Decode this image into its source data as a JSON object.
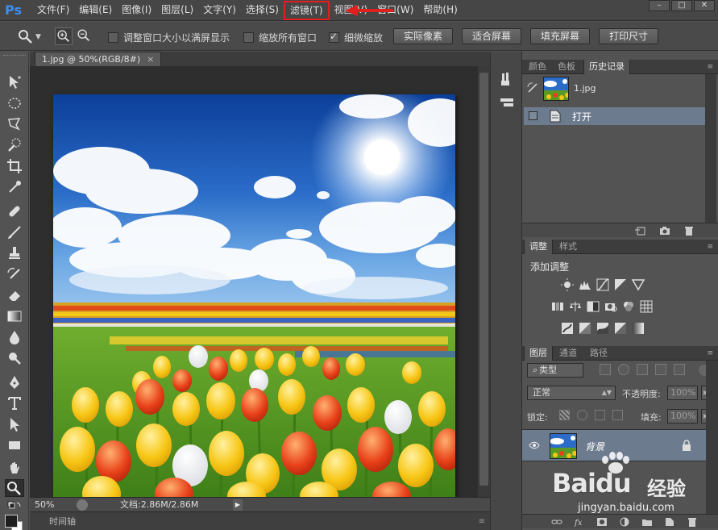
{
  "app": {
    "logo": "Ps",
    "highlight_color": "#e0201f"
  },
  "menubar": {
    "items": [
      "文件(F)",
      "编辑(E)",
      "图像(I)",
      "图层(L)",
      "文字(Y)",
      "选择(S)",
      "滤镜(T)",
      "视图(V)",
      "窗口(W)",
      "帮助(H)"
    ],
    "highlighted_index": 6,
    "window_buttons": [
      "–",
      "□",
      "✕"
    ]
  },
  "options": {
    "checkbox_fit_window": "调整窗口大小以满屏显示",
    "checkbox_zoom_all": "缩放所有窗口",
    "checkbox_scrubby": "细微缩放",
    "scrubby_checked": true,
    "btn_actual": "实际像素",
    "btn_fit": "适合屏幕",
    "btn_fill": "填充屏幕",
    "btn_print": "打印尺寸"
  },
  "document": {
    "tab_title": "1.jpg @ 50%(RGB/8#)",
    "tab_close": "×",
    "zoom": "50%",
    "doc_info": "文档:2.86M/2.86M",
    "timeline_label": "时间轴"
  },
  "history_panel": {
    "tabs": [
      "颜色",
      "色板",
      "历史记录"
    ],
    "active_tab": 2,
    "snapshot_name": "1.jpg",
    "states": [
      "打开"
    ]
  },
  "adjustments_panel": {
    "tabs": [
      "调整",
      "样式"
    ],
    "active_tab": 0,
    "title": "添加调整"
  },
  "layers_panel": {
    "tabs": [
      "图层",
      "通道",
      "路径"
    ],
    "active_tab": 0,
    "filter_kind": "类型",
    "blend_mode": "正常",
    "opacity_label": "不透明度:",
    "opacity_value": "100%",
    "lock_label": "锁定:",
    "fill_label": "填充:",
    "fill_value": "100%",
    "layers": [
      {
        "name": "背景",
        "locked": true,
        "visible": true
      }
    ]
  },
  "watermark": {
    "brand": "Baidu",
    "brand_cn": "经验",
    "url": "jingyan.baidu.com"
  }
}
